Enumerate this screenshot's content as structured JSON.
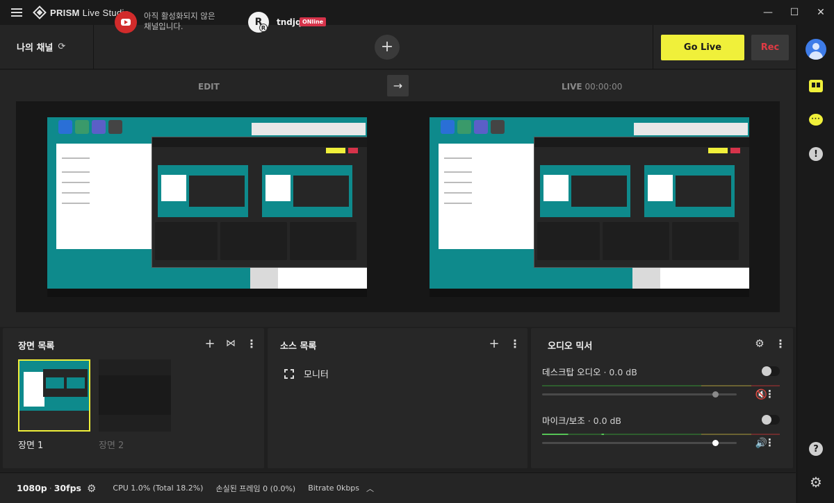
{
  "app": {
    "brand_bold": "PRISM",
    "brand_light": "Live Studio"
  },
  "window_controls": {
    "minimize": "—",
    "maximize": "☐",
    "close": "✕"
  },
  "channels": {
    "my_channel_label": "나의 채널",
    "youtube_status": "아직 활성화되지 않은 채널입니다.",
    "naver_initial": "R",
    "naver_sub_initial": "R",
    "naver_name": "tndjq",
    "naver_badge": "ONline",
    "add_symbol": "+"
  },
  "broadcast": {
    "go_live": "Go Live",
    "rec": "Rec"
  },
  "preview": {
    "edit_label": "EDIT",
    "transition_symbol": "→",
    "live_label": "LIVE",
    "live_time": "00:00:00"
  },
  "scenes": {
    "title": "장면 목록",
    "items": [
      {
        "label": "장면 1",
        "active": true
      },
      {
        "label": "장면 2",
        "active": false
      }
    ]
  },
  "sources": {
    "title": "소스 목록",
    "items": [
      {
        "label": "모니터"
      }
    ]
  },
  "audio_mixer": {
    "title": "오디오 믹서",
    "channels": [
      {
        "name": "데스크탑 오디오",
        "level": "0.0 dB",
        "muted": true,
        "fader": 0.89,
        "knob_color": "#8a8a8a"
      },
      {
        "name": "마이크/보조",
        "level": "0.0 dB",
        "muted": false,
        "fader": 0.89,
        "knob_color": "#ffffff"
      }
    ]
  },
  "status": {
    "resolution": "1080p",
    "fps": "30fps",
    "cpu": "CPU 1.0% (Total 18.2%)",
    "dropped": "손실된 프레임 0 (0.0%)",
    "bitrate": "Bitrate 0kbps"
  },
  "colors": {
    "accent": "#f0f03a",
    "rec_red": "#e03a44",
    "badge_red": "#d6334a",
    "youtube_red": "#d12b2b",
    "desktop_teal": "#0e8a8c"
  }
}
